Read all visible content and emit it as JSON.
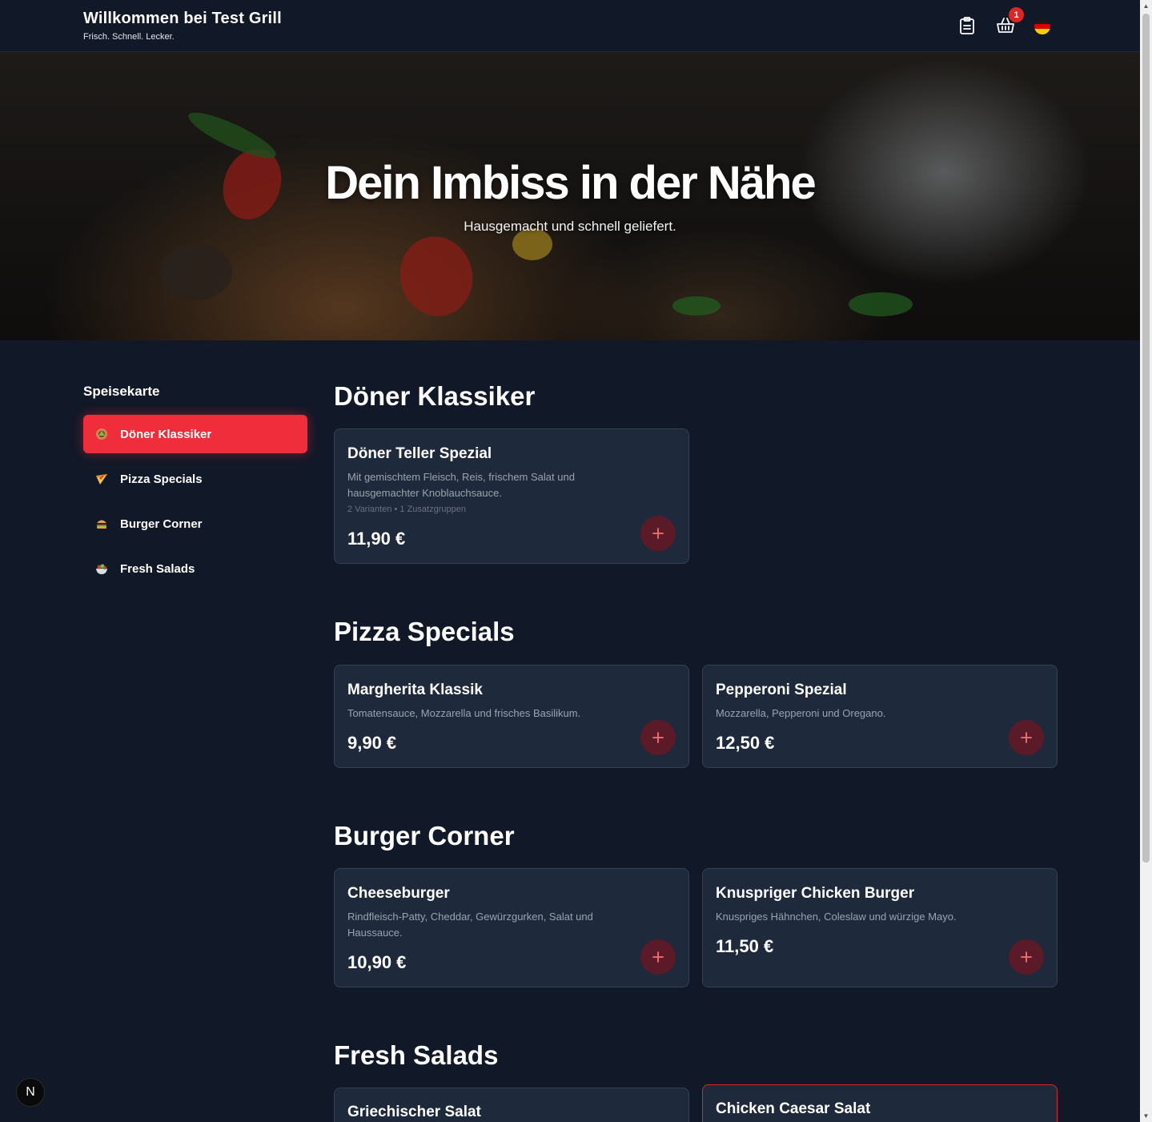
{
  "header": {
    "title": "Willkommen bei Test Grill",
    "subtitle": "Frisch. Schnell. Lecker.",
    "cart_count": "1"
  },
  "hero": {
    "title": "Dein Imbiss in der Nähe",
    "subtitle": "Hausgemacht und schnell geliefert."
  },
  "sidebar": {
    "title": "Speisekarte",
    "items": [
      {
        "label": "Döner Klassiker",
        "icon": "doner-icon",
        "active": true
      },
      {
        "label": "Pizza Specials",
        "icon": "pizza-icon",
        "active": false
      },
      {
        "label": "Burger Corner",
        "icon": "burger-icon",
        "active": false
      },
      {
        "label": "Fresh Salads",
        "icon": "salad-icon",
        "active": false
      }
    ]
  },
  "sections": [
    {
      "title": "Döner Klassiker",
      "items": [
        {
          "name": "Döner Teller Spezial",
          "description": "Mit gemischtem Fleisch, Reis, frischem Salat und hausgemachter Knoblauchsauce.",
          "meta": "2 Varianten • 1 Zusatzgruppen",
          "price": "11,90 €"
        }
      ]
    },
    {
      "title": "Pizza Specials",
      "items": [
        {
          "name": "Margherita Klassik",
          "description": "Tomatensauce, Mozzarella und frisches Basilikum.",
          "price": "9,90 €"
        },
        {
          "name": "Pepperoni Spezial",
          "description": "Mozzarella, Pepperoni und Oregano.",
          "price": "12,50 €"
        }
      ]
    },
    {
      "title": "Burger Corner",
      "items": [
        {
          "name": "Cheeseburger",
          "description": "Rindfleisch-Patty, Cheddar, Gewürzgurken, Salat und Haussauce.",
          "price": "10,90 €"
        },
        {
          "name": "Knuspriger Chicken Burger",
          "description": "Knuspriges Hähnchen, Coleslaw und würzige Mayo.",
          "price": "11,50 €"
        }
      ]
    },
    {
      "title": "Fresh Salads",
      "items": [
        {
          "name": "Griechischer Salat"
        },
        {
          "name": "Chicken Caesar Salat"
        }
      ]
    }
  ],
  "colors": {
    "background": "#111827",
    "card": "#1e293b",
    "accent": "#ef2d3b",
    "add_button": "#5b1a27"
  },
  "dev_badge": "N"
}
